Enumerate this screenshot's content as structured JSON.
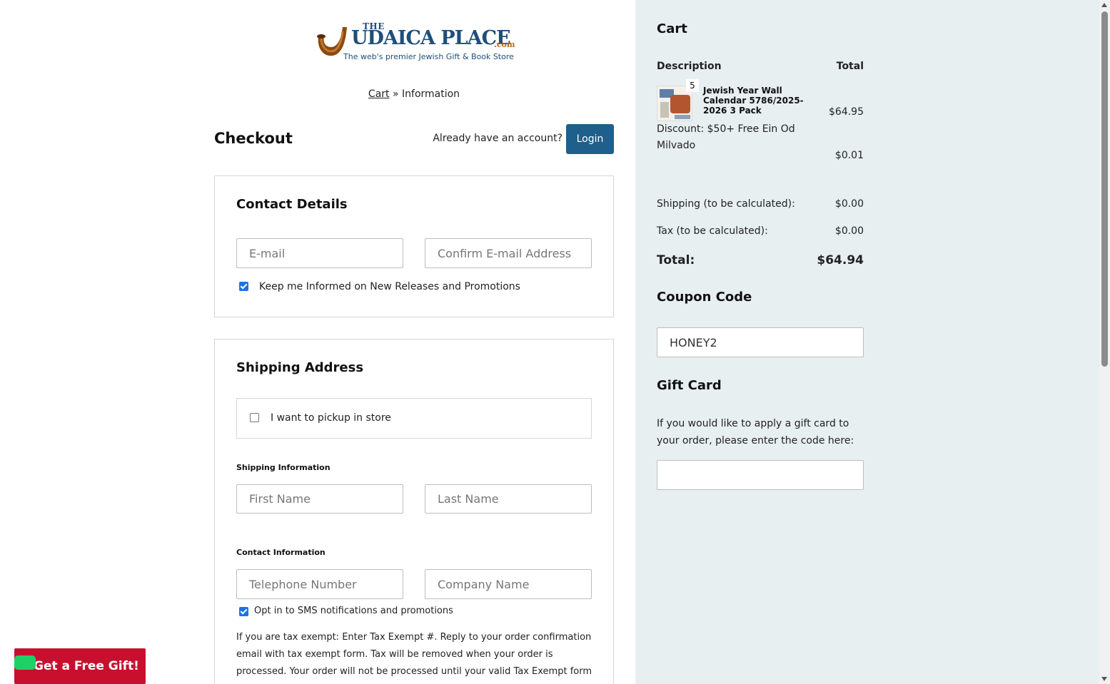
{
  "logo": {
    "the": "THE",
    "name": "UDAICA PLACE",
    "dotcom": ".com",
    "tagline": "The web's premier Jewish Gift & Book Store"
  },
  "breadcrumb": {
    "cart": "Cart",
    "separator": "»",
    "current": "Information"
  },
  "checkout": {
    "title": "Checkout",
    "account_prompt": "Already have an account?",
    "login_label": "Login"
  },
  "contact": {
    "title": "Contact Details",
    "email_placeholder": "E-mail",
    "confirm_email_placeholder": "Confirm E-mail Address",
    "keep_informed_label": "Keep me Informed on New Releases and Promotions",
    "keep_informed_checked": true
  },
  "shipping": {
    "title": "Shipping Address",
    "pickup_label": "I want to pickup in store",
    "pickup_checked": false,
    "shipping_info_heading": "Shipping Information",
    "first_name_placeholder": "First Name",
    "last_name_placeholder": "Last Name",
    "contact_info_heading": "Contact Information",
    "telephone_placeholder": "Telephone Number",
    "company_placeholder": "Company Name",
    "sms_label": "Opt in to SMS notifications and promotions",
    "sms_checked": true,
    "tax_note": "If you are tax exempt: Enter Tax Exempt #. Reply to your order confirmation email with tax exempt form. Tax will be removed when your order is processed. Your order will not be processed until your valid Tax Exempt form has been received"
  },
  "promo": {
    "gift_button": "Get a Free Gift!"
  },
  "cart": {
    "title": "Cart",
    "col_description": "Description",
    "col_total": "Total",
    "items": [
      {
        "quantity": "5",
        "name": "Jewish Year Wall Calendar 5786/2025-2026 3 Pack",
        "price": "$64.95"
      }
    ],
    "discount_label": "Discount: $50+ Free Ein Od Milvado",
    "discount_amount": "$0.01",
    "shipping_label": "Shipping (to be calculated):",
    "shipping_value": "$0.00",
    "tax_label": "Tax (to be calculated):",
    "tax_value": "$0.00",
    "total_label": "Total:",
    "total_value": "$64.94"
  },
  "coupon": {
    "title": "Coupon Code",
    "value": "HONEY2"
  },
  "gift_card": {
    "title": "Gift Card",
    "description": "If you would like to apply a gift card to your order, please enter the code here:",
    "value": ""
  },
  "colors": {
    "primary_button": "#1f5f8b",
    "promo_button": "#c8102e",
    "sidebar_bg": "#e8eff1",
    "checkbox_accent": "#1a73e8"
  }
}
